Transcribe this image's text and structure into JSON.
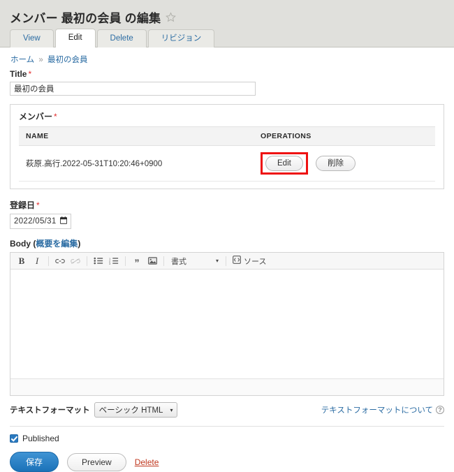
{
  "header": {
    "title": "メンバー 最初の会員 の編集",
    "star_icon": "star-outline-icon",
    "tabs": [
      {
        "label": "View",
        "active": false
      },
      {
        "label": "Edit",
        "active": true
      },
      {
        "label": "Delete",
        "active": false
      },
      {
        "label": "リビジョン",
        "active": false
      }
    ]
  },
  "breadcrumb": {
    "home": "ホーム",
    "separator": "»",
    "current": "最初の会員"
  },
  "title_field": {
    "label": "Title",
    "required_mark": "*",
    "value": "最初の会員"
  },
  "member_field": {
    "label": "メンバー",
    "required_mark": "*",
    "columns": [
      "NAME",
      "OPERATIONS"
    ],
    "rows": [
      {
        "name": "萩原.高行.2022-05-31T10:20:46+0900",
        "edit_label": "Edit",
        "delete_label": "削除",
        "highlighted": true
      }
    ]
  },
  "date_field": {
    "label": "登録日",
    "required_mark": "*",
    "value": "2022/05/31",
    "calendar_icon": "calendar-icon"
  },
  "body_field": {
    "label": "Body",
    "summary_link": "概要を編集",
    "open_paren": "(",
    "close_paren": ")",
    "content": "",
    "toolbar": {
      "bold": "B",
      "italic": "I",
      "link_icon": "link-icon",
      "unlink_icon": "unlink-icon",
      "bullet_list_icon": "bulleted-list-icon",
      "numbered_list_icon": "numbered-list-icon",
      "blockquote": "”",
      "image_icon": "image-icon",
      "format_label": "書式",
      "format_caret": "▾",
      "source_label": "ソース",
      "source_icon": "source-icon"
    }
  },
  "text_format": {
    "label": "テキストフォーマット",
    "selected": "ベーシック HTML",
    "caret": "▾",
    "help_link": "テキストフォーマットについて",
    "help_icon": "question-mark-icon"
  },
  "published": {
    "label": "Published",
    "checked": true
  },
  "actions": {
    "save": "保存",
    "preview": "Preview",
    "delete": "Delete"
  },
  "colors": {
    "header_bg": "#e0e0dc",
    "link": "#2b6ca3",
    "required": "#e22e2e",
    "primary_button": "#2b7ac0",
    "delete_link": "#c0381f",
    "highlight_box": "#ee1111"
  }
}
